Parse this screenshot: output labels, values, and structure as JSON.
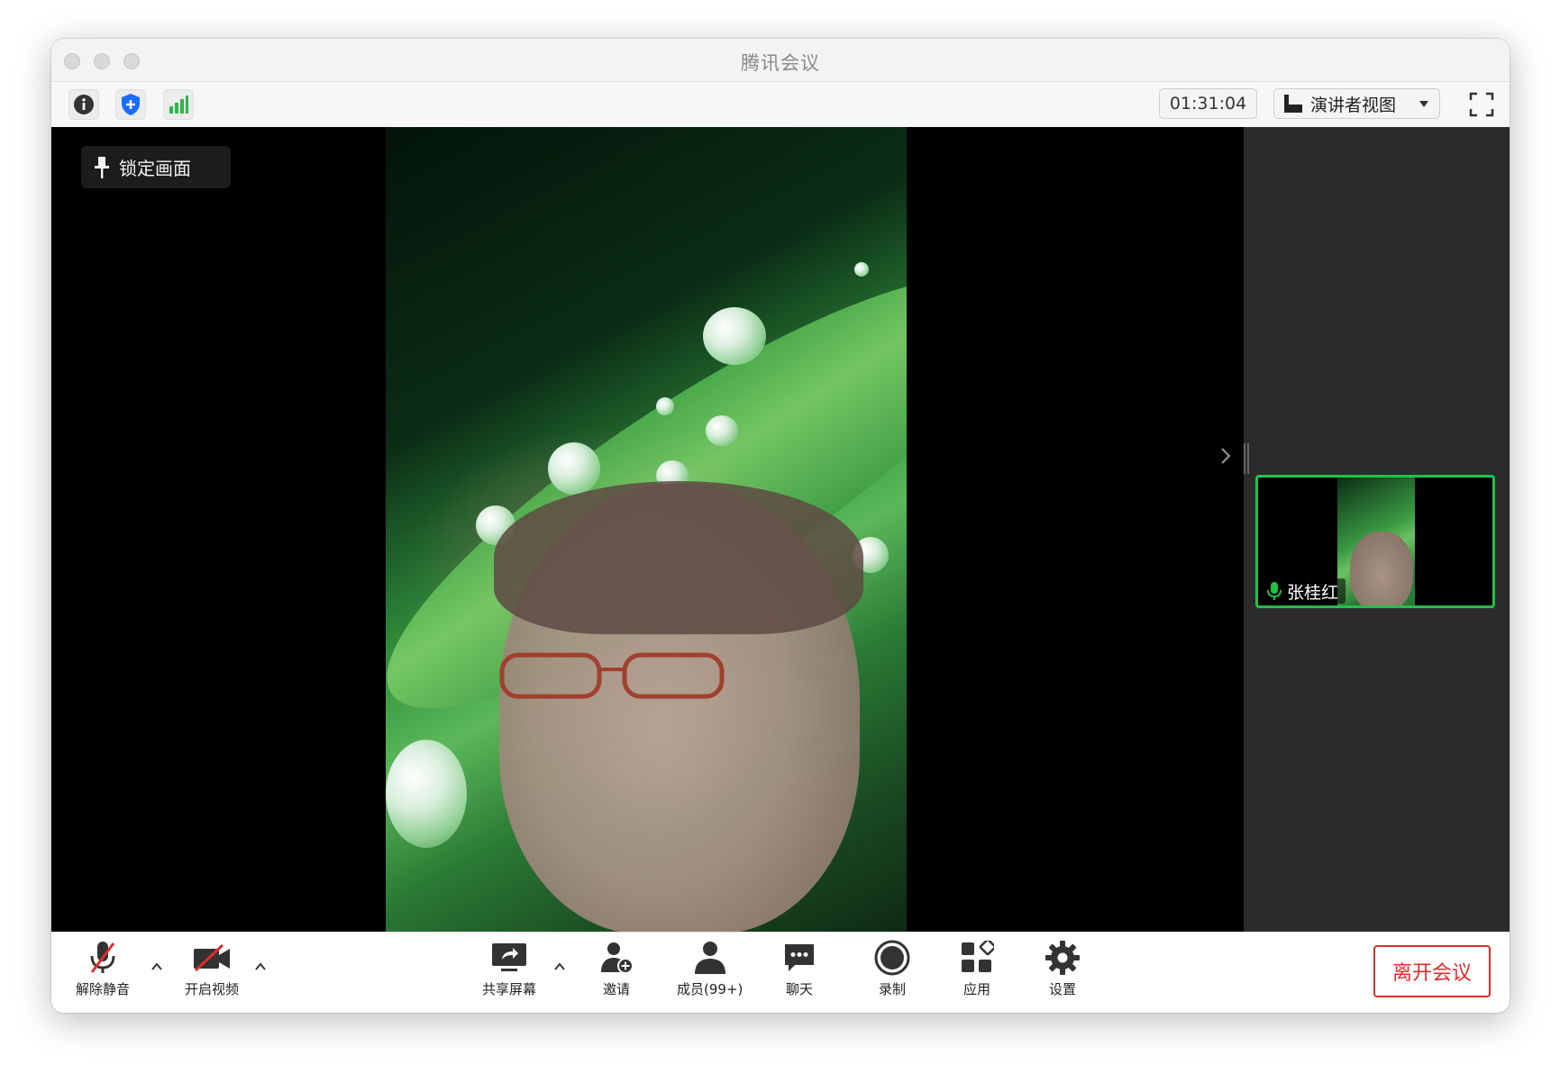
{
  "window": {
    "title": "腾讯会议"
  },
  "toolbar": {
    "info_icon": "info-icon",
    "security_icon": "shield-icon",
    "network_icon": "signal-bars-icon",
    "timer": "01:31:04",
    "view_selector": "演讲者视图",
    "fullscreen_icon": "fullscreen-icon"
  },
  "stage": {
    "lock_label": "锁定画面"
  },
  "sidebar": {
    "participant": {
      "name": "张桂红",
      "mic_status": "unmuted"
    }
  },
  "bottombar": {
    "unmute": "解除静音",
    "start_video": "开启视频",
    "share_screen": "共享屏幕",
    "invite": "邀请",
    "members": "成员(99+)",
    "chat": "聊天",
    "record": "录制",
    "apps": "应用",
    "settings": "设置",
    "leave": "离开会议"
  },
  "colors": {
    "active_speaker_border": "#21c04a",
    "leave_red": "#e02b2b",
    "shield_blue": "#1a6cff",
    "signal_green": "#2db84b"
  }
}
